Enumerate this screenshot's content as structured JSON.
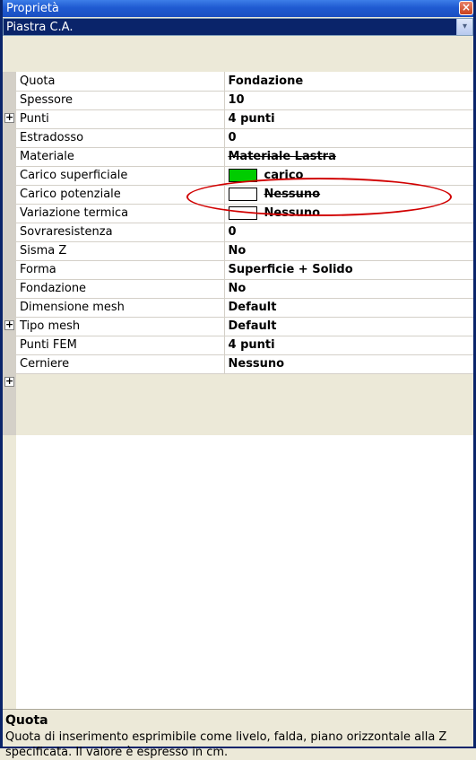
{
  "window": {
    "title": "Proprietà",
    "close": "×"
  },
  "combo": {
    "value": "Piastra C.A.",
    "arrow": "▾"
  },
  "rows": [
    {
      "name": "Quota",
      "value": "Fondazione",
      "expand": ""
    },
    {
      "name": "Spessore",
      "value": "10",
      "expand": ""
    },
    {
      "name": "Punti",
      "value": "4 punti",
      "expand": "+"
    },
    {
      "name": "Estradosso",
      "value": "0",
      "expand": ""
    },
    {
      "name": "Materiale",
      "value": "Materiale Lastra",
      "expand": ""
    },
    {
      "name": "Carico superficiale",
      "value": "carico",
      "expand": ""
    },
    {
      "name": "Carico potenziale",
      "value": "Nessuno",
      "expand": ""
    },
    {
      "name": "Variazione termica",
      "value": "Nessuno",
      "expand": ""
    },
    {
      "name": "Sovraresistenza",
      "value": "0",
      "expand": ""
    },
    {
      "name": "Sisma Z",
      "value": "No",
      "expand": ""
    },
    {
      "name": "Forma",
      "value": "Superficie + Solido",
      "expand": ""
    },
    {
      "name": "Fondazione",
      "value": "No",
      "expand": "+"
    },
    {
      "name": "Dimensione mesh",
      "value": "Default",
      "expand": ""
    },
    {
      "name": "Tipo mesh",
      "value": "Default",
      "expand": ""
    },
    {
      "name": "Punti FEM",
      "value": "4 punti",
      "expand": "+"
    },
    {
      "name": "Cerniere",
      "value": "Nessuno",
      "expand": ""
    }
  ],
  "colors": {
    "carico_swatch": "#00cc00",
    "empty_swatch": "#ffffff",
    "highlight": "#d10000"
  },
  "description": {
    "title": "Quota",
    "text": "Quota di inserimento esprimibile come livelo, falda, piano orizzontale alla Z specificata. Il valore è espresso in cm."
  }
}
